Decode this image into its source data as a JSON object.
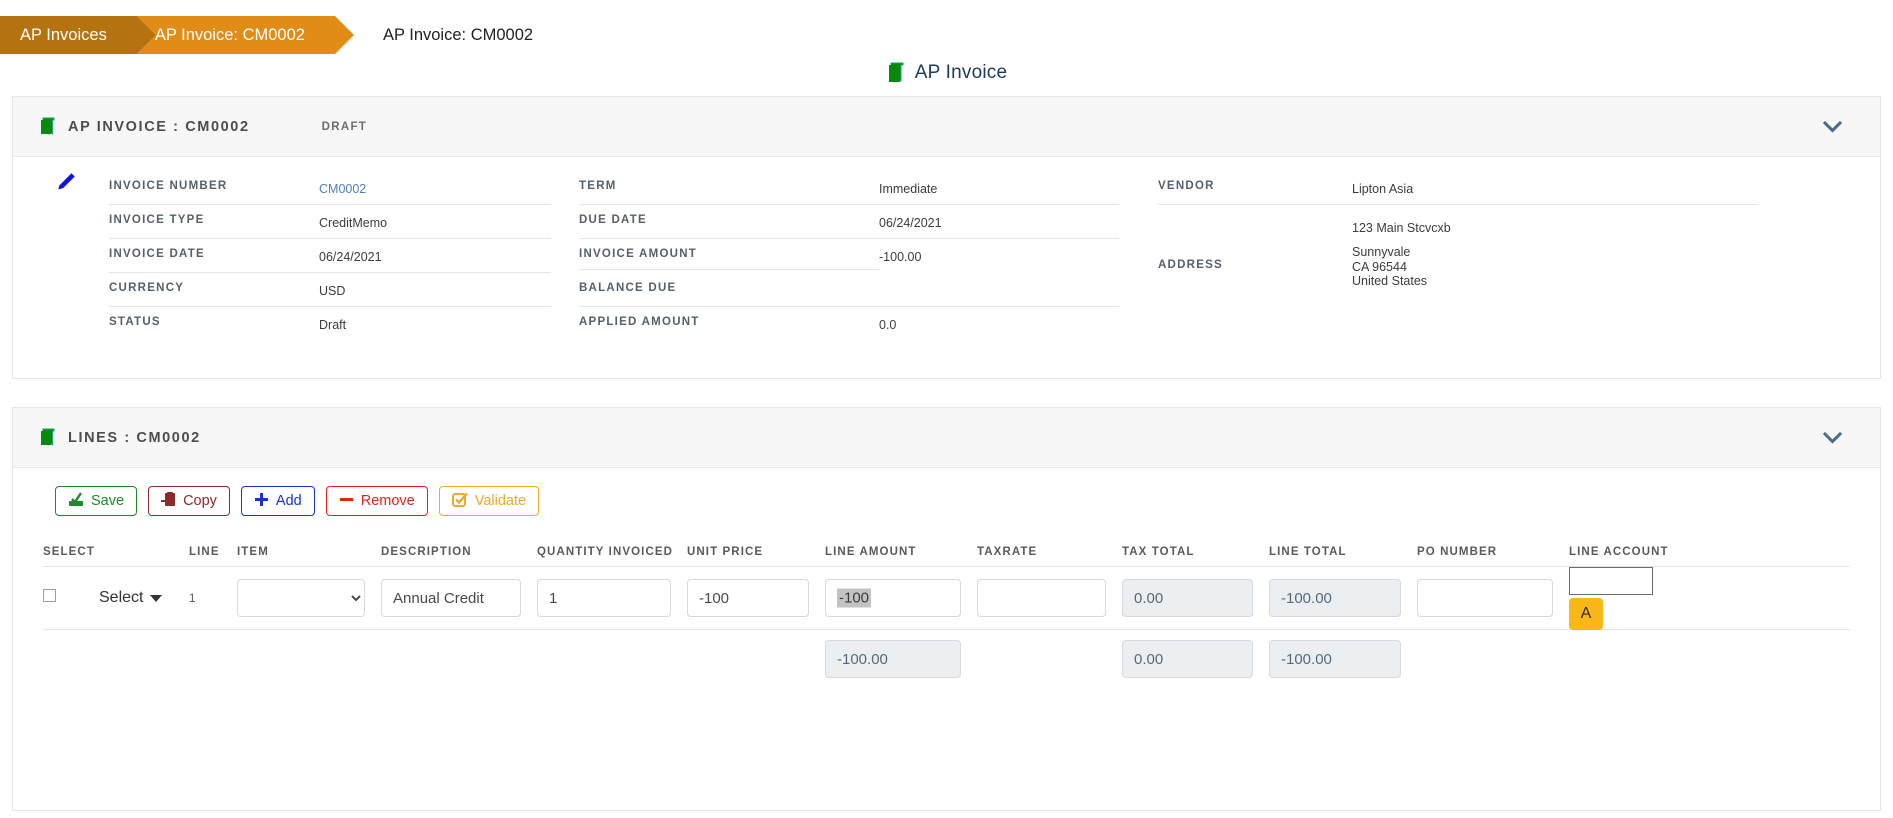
{
  "breadcrumb": {
    "items": [
      {
        "label": "AP Invoices"
      },
      {
        "label": "AP Invoice: CM0002"
      }
    ],
    "current": "AP Invoice: CM0002"
  },
  "page": {
    "title": "AP Invoice",
    "icon": "book-icon"
  },
  "colors": {
    "crumb_first": "#b5730f",
    "crumb_second": "#e08c16",
    "icon_green": "#0a8a0a",
    "link_blue": "#4f7fc0",
    "accent_yellow": "#f9b718"
  },
  "invoice_card": {
    "icon": "bookmark-icon",
    "title": "AP INVOICE : CM0002",
    "status": "DRAFT",
    "collapse_icon": "chevron-down-icon",
    "edit_icon": "pencil-icon",
    "column1": [
      {
        "label": "INVOICE NUMBER",
        "value": "CM0002",
        "is_link": true
      },
      {
        "label": "INVOICE TYPE",
        "value": "CreditMemo"
      },
      {
        "label": "INVOICE DATE",
        "value": "06/24/2021"
      },
      {
        "label": "CURRENCY",
        "value": "USD"
      },
      {
        "label": "STATUS",
        "value": "Draft"
      }
    ],
    "column2": [
      {
        "label": "TERM",
        "value": "Immediate"
      },
      {
        "label": "DUE DATE",
        "value": "06/24/2021"
      },
      {
        "label": "INVOICE AMOUNT",
        "value": "-100.00"
      },
      {
        "label": "BALANCE DUE",
        "value": ""
      },
      {
        "label": "APPLIED AMOUNT",
        "value": "0.0"
      }
    ],
    "column3": {
      "vendor_label": "VENDOR",
      "vendor_value": "Lipton Asia",
      "address_label": "ADDRESS",
      "address_street": "123 Main Stcvcxb",
      "address_city": "Sunnyvale",
      "address_region": "CA 96544",
      "address_country": "United States"
    }
  },
  "lines_card": {
    "icon": "bookmark-icon",
    "title": "LINES : CM0002",
    "collapse_icon": "chevron-down-icon",
    "toolbar": [
      {
        "label": "Save",
        "icon": "save-icon",
        "name": "save-button"
      },
      {
        "label": "Copy",
        "icon": "copy-icon",
        "name": "copy-button"
      },
      {
        "label": "Add",
        "icon": "plus-icon",
        "name": "add-button"
      },
      {
        "label": "Remove",
        "icon": "minus-icon",
        "name": "remove-button"
      },
      {
        "label": "Validate",
        "icon": "validate-icon",
        "name": "validate-button"
      }
    ],
    "headers": {
      "select": "SELECT",
      "line": "LINE",
      "item": "ITEM",
      "description": "DESCRIPTION",
      "quantity_invoiced": "QUANTITY INVOICED",
      "unit_price": "UNIT PRICE",
      "line_amount": "LINE AMOUNT",
      "taxrate": "TAXRATE",
      "tax_total": "TAX TOTAL",
      "line_total": "LINE TOTAL",
      "po_number": "PO NUMBER",
      "line_account": "LINE ACCOUNT"
    },
    "row": {
      "select_dropdown_label": "Select",
      "line_number": "1",
      "item": "",
      "description": "Annual Credit",
      "quantity_invoiced": "1",
      "unit_price": "-100",
      "line_amount": "-100",
      "line_amount_selected": true,
      "taxrate": "",
      "tax_total": "0.00",
      "line_total": "-100.00",
      "po_number": "",
      "line_account": "",
      "line_account_button": "A"
    },
    "totals": {
      "line_amount": "-100.00",
      "tax_total": "0.00",
      "line_total": "-100.00"
    }
  }
}
